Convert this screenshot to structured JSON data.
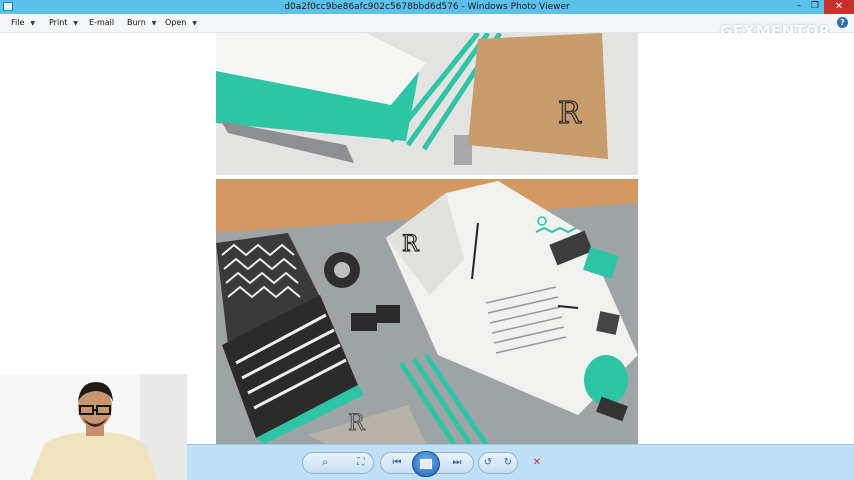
{
  "window": {
    "title": "d0a2f0cc9be86afc902c5678bbd6d576 - Windows Photo Viewer",
    "minimize_glyph": "–",
    "maximize_glyph": "❐",
    "close_glyph": "✕"
  },
  "watermark": "GFXMENTOR",
  "menu": {
    "file": "File",
    "print": "Print",
    "email": "E-mail",
    "burn": "Burn",
    "open": "Open",
    "help_glyph": "?"
  },
  "toolbar": {
    "zoom_glyph": "⌕",
    "actual_size_glyph": "⛶",
    "previous_glyph": "⏮",
    "next_glyph": "⏭",
    "rotate_ccw_glyph": "↺",
    "rotate_cw_glyph": "↻",
    "delete_glyph": "✕"
  },
  "colors": {
    "titlebar": "#5cc1ea",
    "bottombar": "#bfe0f4",
    "accent_teal": "#2ec4a6",
    "delete_red": "#d3262b"
  }
}
